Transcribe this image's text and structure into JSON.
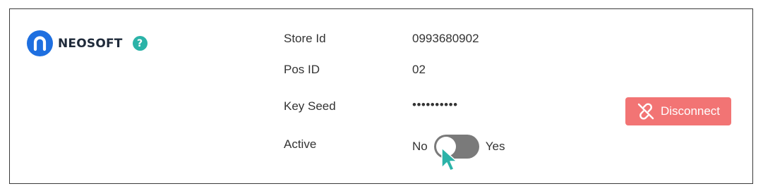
{
  "brand": {
    "name": "NEOSOFT",
    "help_glyph": "?",
    "logo_color": "#1e6fe0",
    "help_color": "#2bb3a8"
  },
  "fields": {
    "store_id_label": "Store Id",
    "store_id_value": "0993680902",
    "pos_id_label": "Pos ID",
    "pos_id_value": "02",
    "key_seed_label": "Key Seed",
    "key_seed_value": "••••••••••",
    "active_label": "Active"
  },
  "toggle": {
    "off_label": "No",
    "on_label": "Yes",
    "state": "off",
    "track_color": "#7a7a7a"
  },
  "actions": {
    "disconnect_label": "Disconnect",
    "disconnect_icon": "broken-link-icon",
    "disconnect_color": "#f27474"
  },
  "cursor": {
    "icon": "pointer-cursor-icon",
    "color": "#2bb3a8"
  }
}
